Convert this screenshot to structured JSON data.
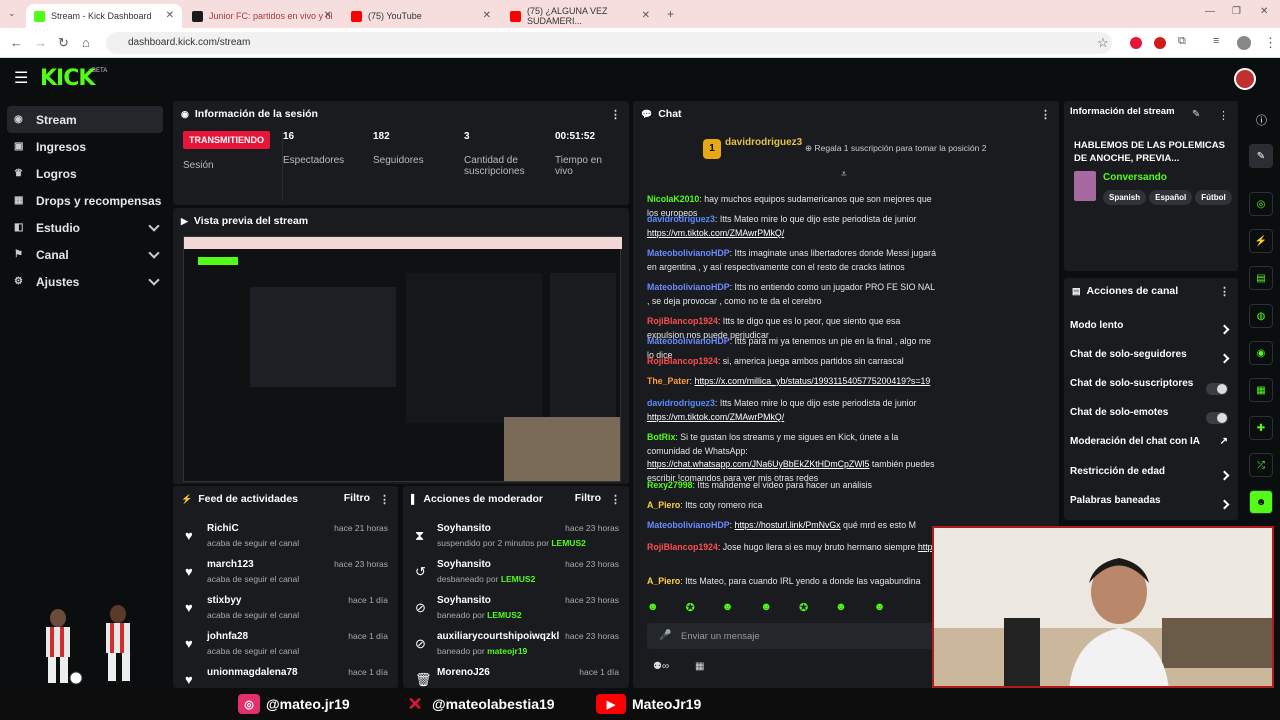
{
  "browser": {
    "tabs": [
      {
        "title": "Stream - Kick Dashboard",
        "color": "#53fc18"
      },
      {
        "title": "Junior FC: partidos en vivo y úl",
        "color": "#1a1a1a"
      },
      {
        "title": "(75) YouTube",
        "color": "#ff0000"
      },
      {
        "title": "(75) ¿ALGUNA VEZ SUDAMERI...",
        "color": "#ff0000"
      }
    ],
    "url": "dashboard.kick.com/stream"
  },
  "kick": {
    "logo": "KICK",
    "beta": "BETA"
  },
  "sidebar": {
    "items": [
      {
        "label": "Stream",
        "icon": "radio-icon"
      },
      {
        "label": "Ingresos",
        "icon": "revenue-icon"
      },
      {
        "label": "Logros",
        "icon": "trophy-icon"
      },
      {
        "label": "Drops y recompensas",
        "icon": "gift-icon"
      },
      {
        "label": "Estudio",
        "icon": "studio-icon"
      },
      {
        "label": "Canal",
        "icon": "flag-icon"
      },
      {
        "label": "Ajustes",
        "icon": "gear-icon"
      }
    ]
  },
  "session": {
    "title": "Información de la sesión",
    "status": "TRANSMITIENDO",
    "status_label": "Sesión",
    "viewers": "16",
    "viewers_label": "Espectadores",
    "followers": "182",
    "followers_label": "Seguidores",
    "subs": "3",
    "subs_label": "Cantidad de suscripciones",
    "time": "00:51:52",
    "time_label": "Tiempo en vivo"
  },
  "preview": {
    "title": "Vista previa del stream"
  },
  "feed": {
    "title": "Feed de actividades",
    "filter": "Filtro",
    "rows": [
      {
        "name": "RichiC",
        "sub": "acaba de seguir el canal",
        "time": "hace 21 horas"
      },
      {
        "name": "march123",
        "sub": "acaba de seguir el canal",
        "time": "hace 23 horas"
      },
      {
        "name": "stixbyy",
        "sub": "acaba de seguir el canal",
        "time": "hace 1 día"
      },
      {
        "name": "johnfa28",
        "sub": "acaba de seguir el canal",
        "time": "hace 1 día"
      },
      {
        "name": "unionmagdalena78",
        "sub": "",
        "time": "hace 1 día"
      }
    ]
  },
  "mod": {
    "title": "Acciones de moderador",
    "filter": "Filtro",
    "rows": [
      {
        "name": "Soyhansito",
        "pre": "suspendido por 2 minutos por ",
        "by": "LEMUS2",
        "time": "hace 23 horas"
      },
      {
        "name": "Soyhansito",
        "pre": "desbaneado por ",
        "by": "LEMUS2",
        "time": "hace 23 horas"
      },
      {
        "name": "Soyhansito",
        "pre": "baneado por ",
        "by": "LEMUS2",
        "time": "hace 23 horas"
      },
      {
        "name": "auxiliarycourtshipoiwqzkl",
        "pre": "baneado por ",
        "by": "mateojr19",
        "time": "hace 23 horas"
      },
      {
        "name": "MorenoJ26",
        "pre": "",
        "by": "",
        "time": "hace 1 día"
      }
    ]
  },
  "chat": {
    "title": "Chat",
    "pinned_user": "davidrodriguez3",
    "pinned_rank": "1",
    "gift_text": "Regala 1 suscripción para tomar la posición 2",
    "messages": [
      {
        "user": "NicolaK2010",
        "color": "#53fc18",
        "text": "hay muchos equipos sudamericanos que son mejores que los europeos",
        "link": ""
      },
      {
        "user": "davidrodriguez3",
        "color": "#5b8cff",
        "text": "Itts Mateo mire lo que dijo este periodista de junior",
        "link": "https://vm.tiktok.com/ZMAwrPMkQ/"
      },
      {
        "user": "MateobolivianoHDP",
        "color": "#6b8cff",
        "text": "Itts imaginate unas libertadores donde Messi jugará en argentina , y así respectivamente con el resto de cracks latinos",
        "link": ""
      },
      {
        "user": "MateobolivianoHDP",
        "color": "#6b8cff",
        "text": "Itts no entiendo como un jugador PRO FE SIO NAL , se deja provocar , como no te da el cerebro",
        "link": ""
      },
      {
        "user": "RojiBlancop1924",
        "color": "#ff4d4d",
        "text": "Itts te digo que es lo peor, que siento que esa expulsion nos puede perjudicar",
        "link": ""
      },
      {
        "user": "MateobolivianoHDP",
        "color": "#6b8cff",
        "text": "Itts para mi ya tenemos un pie en la final , algo me lo dice",
        "link": ""
      },
      {
        "user": "RojiBlancop1924",
        "color": "#ff4d4d",
        "text": "si, america juega ambos partidos sin carrascal",
        "link": ""
      },
      {
        "user": "The_Pater",
        "color": "#ff9a3c",
        "text": "",
        "link": "https://x.com/millica_yb/status/1993115405775200419?s=19"
      },
      {
        "user": "davidrodriguez3",
        "color": "#5b8cff",
        "text": "Itts Mateo mire lo que dijo este periodista de junior",
        "link": "https://vm.tiktok.com/ZMAwrPMkQ/"
      },
      {
        "user": "BotRix",
        "color": "#53fc18",
        "text": "Si te gustan los streams y me sigues en Kick, únete a la comunidad de WhatsApp:",
        "link": "https://chat.whatsapp.com/JNa6UyBbEkZKtHDmCpZWl5",
        "tail": "también puedes escribir !comandos para ver mis otras redes"
      },
      {
        "user": "Rexy27998",
        "color": "#53fc18",
        "text": "Itts mándeme el video para hacer un análisis",
        "link": ""
      },
      {
        "user": "A_Piero",
        "color": "#ffd43b",
        "text": "Itts coty romero rica",
        "link": ""
      },
      {
        "user": "MateobolivianoHDP",
        "color": "#6b8cff",
        "text": "",
        "link": "https://hosturl.link/PmNvGx",
        "tail": "qué mrd es esto M"
      },
      {
        "user": "RojiBlancop1924",
        "color": "#ff4d4d",
        "text": "Jose hugo llera si es muy bruto hermano siempre",
        "link": "https://www.tiktok.com/@jacqueelgr/video/7573440140756929814"
      },
      {
        "user": "A_Piero",
        "color": "#ffd43b",
        "text": "Itts Mateo, para cuando IRL yendo a donde las vagabundina",
        "link": ""
      }
    ],
    "placeholder": "Enviar un mensaje"
  },
  "stream_info": {
    "title": "Información del stream",
    "stream_title": "HABLEMOS DE LAS POLEMICAS DE ANOCHE, PREVIA...",
    "category": "Conversando",
    "tags": [
      "Spanish",
      "Español",
      "Fútbol"
    ]
  },
  "channel_actions": {
    "title": "Acciones de canal",
    "items": [
      {
        "label": "Modo lento",
        "kind": "chevron"
      },
      {
        "label": "Chat de solo-seguidores",
        "kind": "chevron"
      },
      {
        "label": "Chat de solo-suscriptores",
        "kind": "toggle"
      },
      {
        "label": "Chat de solo-emotes",
        "kind": "toggle"
      },
      {
        "label": "Moderación del chat con IA",
        "kind": "chart"
      },
      {
        "label": "Restricción de edad",
        "kind": "chevron"
      },
      {
        "label": "Palabras baneadas",
        "kind": "chevron"
      }
    ]
  },
  "socials": [
    {
      "handle": "@mateo.jr19",
      "icon": "instagram-icon",
      "color": "#e1306c"
    },
    {
      "handle": "@mateolabestia19",
      "icon": "x-icon",
      "color": "#e8153b"
    },
    {
      "handle": "MateoJr19",
      "icon": "youtube-icon",
      "color": "#ff0000"
    }
  ]
}
